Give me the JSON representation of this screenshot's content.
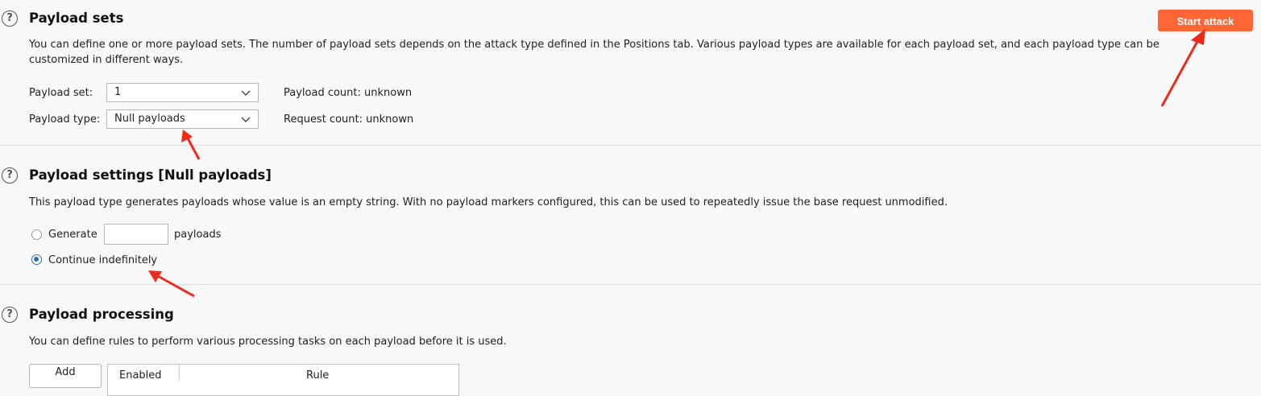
{
  "payload_sets": {
    "title": "Payload sets",
    "description_line1": "You can define one or more payload sets. The number of payload sets depends on the attack type defined in the Positions tab. Various payload types are available for each payload set, and each payload type can be",
    "description_line2": "customized in different ways.",
    "set_label": "Payload set:",
    "set_value": "1",
    "type_label": "Payload type:",
    "type_value": "Null payloads",
    "payload_count": "Payload count: unknown",
    "request_count": "Request count: unknown",
    "start_attack_label": "Start attack"
  },
  "payload_settings": {
    "title": "Payload settings [Null payloads]",
    "description": "This payload type generates payloads whose value is an empty string. With no payload markers configured, this can be used to repeatedly issue the base request unmodified.",
    "generate_label": "Generate",
    "generate_value": "",
    "payloads_suffix": "payloads",
    "continue_label": "Continue indefinitely",
    "selected_option": "continue"
  },
  "payload_processing": {
    "title": "Payload processing",
    "description": "You can define rules to perform various processing tasks on each payload before it is used.",
    "add_label": "Add",
    "table_columns": [
      "Enabled",
      "Rule"
    ]
  },
  "help_glyph": "?",
  "colors": {
    "accent": "#ff6633",
    "annotation_arrow": "#ee2a1a",
    "radio_selected": "#2a6cb2"
  }
}
